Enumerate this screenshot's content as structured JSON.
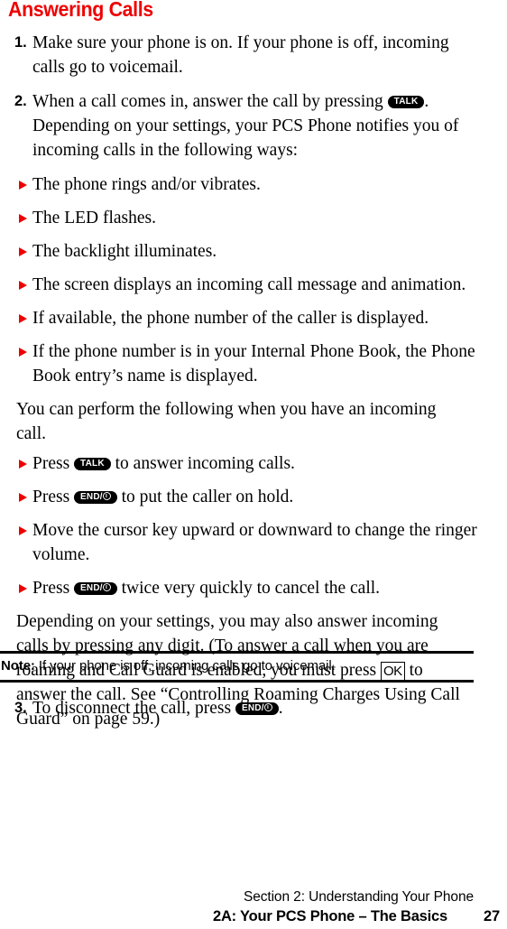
{
  "page": {
    "title": "Answering Calls",
    "title_color": "#ee0000",
    "bullet_color": "#ee0000"
  },
  "steps": [
    {
      "num": "1.",
      "text": "Make sure your phone is on. If your phone is off, incoming calls go to voicemail."
    },
    {
      "num": "2.",
      "text_before": "When a call comes in, answer the call by pressing ",
      "key": "TALK",
      "text_after": ". Depending on your settings, your PCS Phone notifies you of incoming calls in the following ways:"
    }
  ],
  "notify_bullets": [
    {
      "text": "The phone rings and/or vibrates."
    },
    {
      "text": "The LED flashes."
    },
    {
      "text": "The backlight illuminates."
    },
    {
      "text": "The screen displays an incoming call message and animation."
    },
    {
      "text": "If available, the phone number of the caller is displayed."
    },
    {
      "text": "If the phone number is in your Internal Phone Book, the Phone Book entry’s name is displayed."
    }
  ],
  "incoming_intro": "You can perform the following when you have an incoming call.",
  "action_bullets": [
    {
      "text_before": "Press ",
      "key": "TALK",
      "key_type": "talk",
      "text_after": " to answer incoming calls."
    },
    {
      "text_before": "Press ",
      "key": "END/",
      "key_type": "end",
      "text_after": " to put the caller on hold."
    },
    {
      "text_before": "Move the cursor key upward or downward to change the ringer volume.",
      "key": "",
      "key_type": "none",
      "text_after": ""
    },
    {
      "text_before": "Press ",
      "key": "END/",
      "key_type": "end",
      "text_after": " twice very quickly to cancel the call."
    }
  ],
  "closing_paragraph": {
    "part1": "Depending on your settings, you may also answer incoming calls by pressing any digit. (To answer a call when you are roaming and Call Guard is enabled, you must press ",
    "ok_key": "OK",
    "part2": " to answer the call. See “Controlling Roaming Charges Using Call Guard” on page 59.)"
  },
  "note": {
    "label": "Note:",
    "text": " If your phone is off, incoming calls go to voicemail."
  },
  "step3": {
    "num": "3.",
    "text_before": "To disconnect the call, press ",
    "key": "END/",
    "text_after": "."
  },
  "footer": {
    "line1": "Section 2: Understanding Your Phone",
    "line2": "2A: Your PCS Phone – The Basics",
    "page_number": "27"
  }
}
